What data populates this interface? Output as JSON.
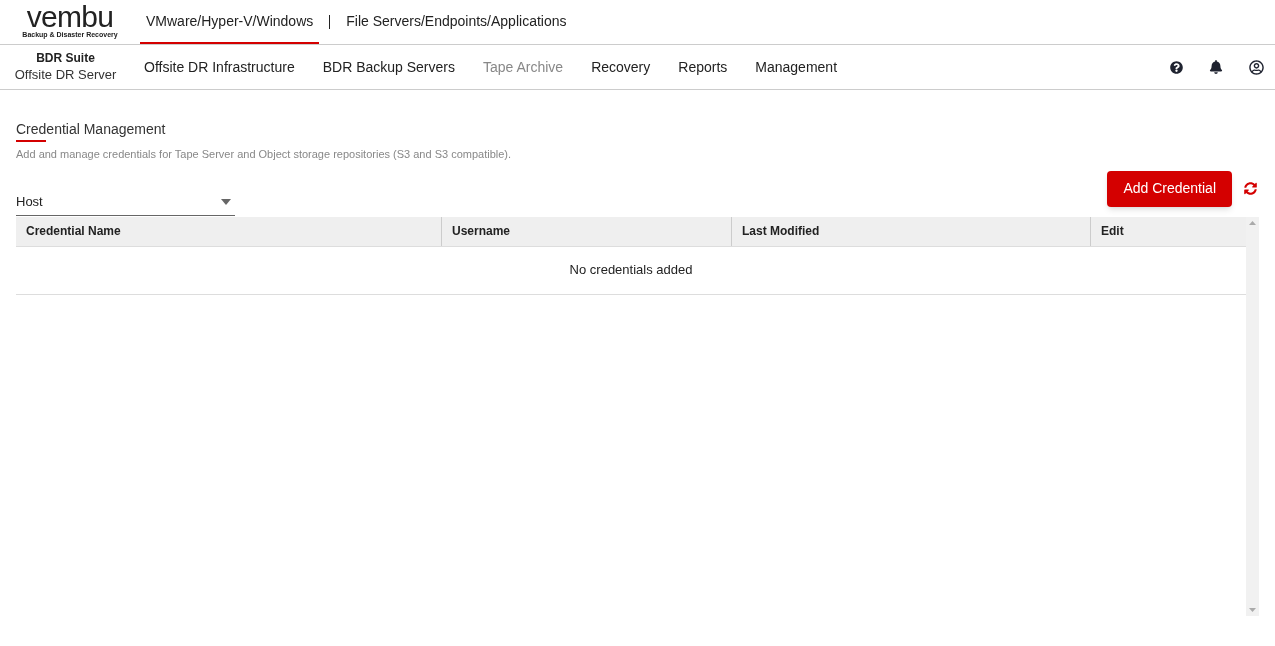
{
  "logo": {
    "word": "vembu",
    "tagline": "Backup & Disaster Recovery"
  },
  "product_tabs": [
    {
      "label": "VMware/Hyper-V/Windows",
      "selected": true
    },
    {
      "label": "File Servers/Endpoints/Applications",
      "selected": false
    }
  ],
  "suite": {
    "name": "BDR Suite",
    "server": "Offsite DR Server"
  },
  "nav": [
    {
      "label": "Offsite DR Infrastructure",
      "disabled": false
    },
    {
      "label": "BDR Backup Servers",
      "disabled": false
    },
    {
      "label": "Tape Archive",
      "disabled": true
    },
    {
      "label": "Recovery",
      "disabled": false
    },
    {
      "label": "Reports",
      "disabled": false
    },
    {
      "label": "Management",
      "disabled": false
    }
  ],
  "page": {
    "title": "Credential Management",
    "description": "Add and manage credentials for Tape Server and Object storage repositories (S3 and S3 compatible)."
  },
  "filter": {
    "value": "Host"
  },
  "add_button": "Add Credential",
  "table": {
    "columns": [
      "Credential Name",
      "Username",
      "Last Modified",
      "Edit"
    ],
    "empty_message": "No credentials added"
  }
}
